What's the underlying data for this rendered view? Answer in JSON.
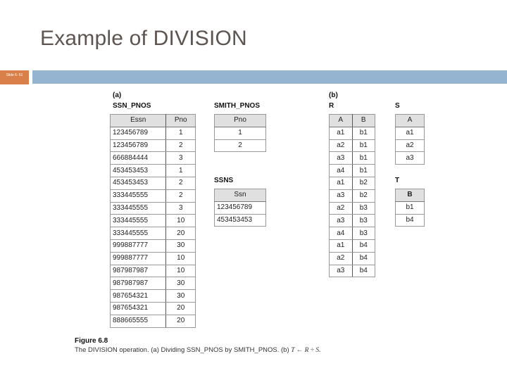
{
  "slide": {
    "title": "Example of DIVISION",
    "slide_number": "Slide 6- 51",
    "accent_color": "#d9804a",
    "bar_color": "#94b4d0"
  },
  "figure": {
    "part_a_label": "(a)",
    "part_b_label": "(b)",
    "ssn_pnos": {
      "name": "SSN_PNOS",
      "columns": [
        "Essn",
        "Pno"
      ],
      "rows": [
        [
          "123456789",
          "1"
        ],
        [
          "123456789",
          "2"
        ],
        [
          "666884444",
          "3"
        ],
        [
          "453453453",
          "1"
        ],
        [
          "453453453",
          "2"
        ],
        [
          "333445555",
          "2"
        ],
        [
          "333445555",
          "3"
        ],
        [
          "333445555",
          "10"
        ],
        [
          "333445555",
          "20"
        ],
        [
          "999887777",
          "30"
        ],
        [
          "999887777",
          "10"
        ],
        [
          "987987987",
          "10"
        ],
        [
          "987987987",
          "30"
        ],
        [
          "987654321",
          "30"
        ],
        [
          "987654321",
          "20"
        ],
        [
          "888665555",
          "20"
        ]
      ]
    },
    "smith_pnos": {
      "name": "SMITH_PNOS",
      "columns": [
        "Pno"
      ],
      "rows": [
        [
          "1"
        ],
        [
          "2"
        ]
      ]
    },
    "ssns": {
      "name": "SSNS",
      "columns": [
        "Ssn"
      ],
      "rows": [
        [
          "123456789"
        ],
        [
          "453453453"
        ]
      ]
    },
    "r": {
      "name": "R",
      "columns": [
        "A",
        "B"
      ],
      "rows": [
        [
          "a1",
          "b1"
        ],
        [
          "a2",
          "b1"
        ],
        [
          "a3",
          "b1"
        ],
        [
          "a4",
          "b1"
        ],
        [
          "a1",
          "b2"
        ],
        [
          "a3",
          "b2"
        ],
        [
          "a2",
          "b3"
        ],
        [
          "a3",
          "b3"
        ],
        [
          "a4",
          "b3"
        ],
        [
          "a1",
          "b4"
        ],
        [
          "a2",
          "b4"
        ],
        [
          "a3",
          "b4"
        ]
      ]
    },
    "s": {
      "name": "S",
      "columns": [
        "A"
      ],
      "rows": [
        [
          "a1"
        ],
        [
          "a2"
        ],
        [
          "a3"
        ]
      ]
    },
    "t": {
      "name": "T",
      "columns": [
        "B"
      ],
      "rows": [
        [
          "b1"
        ],
        [
          "b4"
        ]
      ]
    },
    "caption": {
      "title": "Figure 6.8",
      "text_before": "The DIVISION operation. (a) Dividing SSN_PNOS by SMITH_PNOS. (b) ",
      "formula": "T ← R ÷ S."
    }
  }
}
